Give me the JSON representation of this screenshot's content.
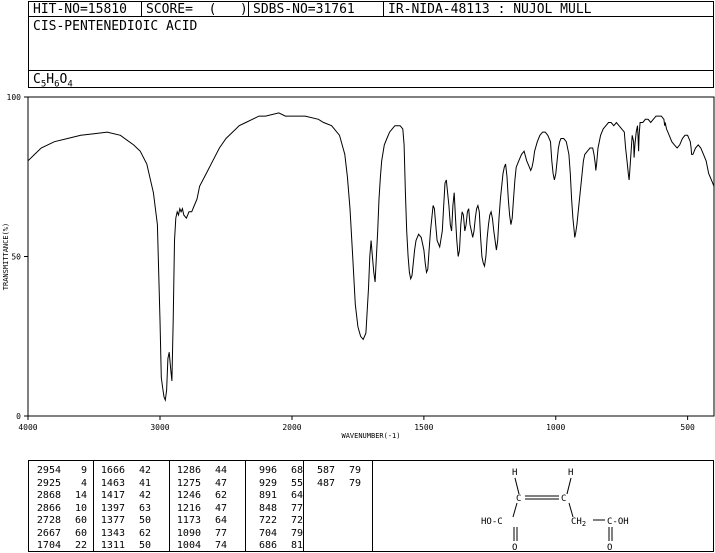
{
  "header": {
    "hit_no": "HIT-NO=15810",
    "score": "SCORE=  (   )",
    "sdbs_no": "SDBS-NO=31761",
    "ir_info": "IR-NIDA-48113 : NUJOL MULL"
  },
  "compound_name": "CIS-PENTENEDIOIC ACID",
  "formula": {
    "c": "C",
    "c_n": "5",
    "h": "H",
    "h_n": "6",
    "o": "O",
    "o_n": "4"
  },
  "chart_data": {
    "type": "line",
    "title": "",
    "xlabel": "WAVENUMBER(-1)",
    "ylabel": "TRANSMITTANCE(%)",
    "xlim": [
      4000,
      400
    ],
    "ylim": [
      0,
      100
    ],
    "x_ticks": [
      "4000",
      "3000",
      "2000",
      "1500",
      "1000",
      "500"
    ],
    "y_ticks": [
      "100",
      "50",
      "0"
    ],
    "grid": false,
    "series": [
      {
        "points": [
          [
            4000,
            80
          ],
          [
            3950,
            82
          ],
          [
            3900,
            84
          ],
          [
            3800,
            86
          ],
          [
            3700,
            87
          ],
          [
            3600,
            88
          ],
          [
            3500,
            88.5
          ],
          [
            3400,
            89
          ],
          [
            3300,
            88
          ],
          [
            3200,
            85
          ],
          [
            3150,
            83
          ],
          [
            3100,
            79
          ],
          [
            3050,
            70
          ],
          [
            3020,
            60
          ],
          [
            3000,
            30
          ],
          [
            2990,
            12
          ],
          [
            2980,
            9
          ],
          [
            2970,
            6
          ],
          [
            2960,
            5
          ],
          [
            2950,
            8
          ],
          [
            2940,
            18
          ],
          [
            2930,
            20
          ],
          [
            2920,
            15
          ],
          [
            2910,
            11
          ],
          [
            2900,
            30
          ],
          [
            2890,
            55
          ],
          [
            2880,
            62
          ],
          [
            2870,
            64
          ],
          [
            2860,
            63
          ],
          [
            2850,
            65
          ],
          [
            2840,
            64
          ],
          [
            2830,
            65
          ],
          [
            2820,
            63
          ],
          [
            2800,
            62
          ],
          [
            2780,
            64
          ],
          [
            2760,
            64
          ],
          [
            2740,
            66
          ],
          [
            2720,
            68
          ],
          [
            2700,
            72
          ],
          [
            2650,
            76
          ],
          [
            2600,
            80
          ],
          [
            2550,
            84
          ],
          [
            2500,
            87
          ],
          [
            2450,
            89
          ],
          [
            2400,
            91
          ],
          [
            2350,
            92
          ],
          [
            2300,
            93
          ],
          [
            2250,
            94
          ],
          [
            2200,
            94
          ],
          [
            2100,
            95
          ],
          [
            2050,
            94
          ],
          [
            2000,
            94
          ],
          [
            1950,
            94
          ],
          [
            1900,
            93
          ],
          [
            1880,
            92
          ],
          [
            1850,
            91
          ],
          [
            1820,
            88
          ],
          [
            1800,
            82
          ],
          [
            1790,
            75
          ],
          [
            1780,
            65
          ],
          [
            1770,
            50
          ],
          [
            1760,
            35
          ],
          [
            1750,
            28
          ],
          [
            1740,
            25
          ],
          [
            1730,
            24
          ],
          [
            1720,
            26
          ],
          [
            1710,
            40
          ],
          [
            1705,
            50
          ],
          [
            1700,
            55
          ],
          [
            1695,
            50
          ],
          [
            1690,
            45
          ],
          [
            1685,
            42
          ],
          [
            1680,
            50
          ],
          [
            1675,
            58
          ],
          [
            1670,
            68
          ],
          [
            1665,
            75
          ],
          [
            1660,
            80
          ],
          [
            1650,
            85
          ],
          [
            1640,
            87
          ],
          [
            1630,
            89
          ],
          [
            1620,
            90
          ],
          [
            1610,
            91
          ],
          [
            1600,
            91
          ],
          [
            1590,
            91
          ],
          [
            1580,
            90
          ],
          [
            1575,
            85
          ],
          [
            1570,
            70
          ],
          [
            1565,
            58
          ],
          [
            1560,
            50
          ],
          [
            1555,
            45
          ],
          [
            1550,
            43
          ],
          [
            1545,
            44
          ],
          [
            1540,
            48
          ],
          [
            1535,
            52
          ],
          [
            1530,
            55
          ],
          [
            1520,
            57
          ],
          [
            1510,
            56
          ],
          [
            1500,
            52
          ],
          [
            1495,
            48
          ],
          [
            1490,
            45
          ],
          [
            1485,
            46
          ],
          [
            1480,
            52
          ],
          [
            1475,
            58
          ],
          [
            1470,
            62
          ],
          [
            1465,
            66
          ],
          [
            1460,
            65
          ],
          [
            1455,
            60
          ],
          [
            1450,
            55
          ],
          [
            1440,
            53
          ],
          [
            1430,
            58
          ],
          [
            1425,
            66
          ],
          [
            1420,
            73
          ],
          [
            1415,
            74
          ],
          [
            1410,
            70
          ],
          [
            1405,
            66
          ],
          [
            1400,
            60
          ],
          [
            1395,
            58
          ],
          [
            1390,
            66
          ],
          [
            1385,
            70
          ],
          [
            1380,
            62
          ],
          [
            1375,
            55
          ],
          [
            1370,
            50
          ],
          [
            1365,
            52
          ],
          [
            1360,
            60
          ],
          [
            1355,
            64
          ],
          [
            1350,
            63
          ],
          [
            1345,
            58
          ],
          [
            1340,
            60
          ],
          [
            1335,
            64
          ],
          [
            1330,
            65
          ],
          [
            1325,
            60
          ],
          [
            1320,
            58
          ],
          [
            1315,
            56
          ],
          [
            1310,
            58
          ],
          [
            1305,
            62
          ],
          [
            1300,
            65
          ],
          [
            1295,
            66
          ],
          [
            1290,
            64
          ],
          [
            1285,
            56
          ],
          [
            1280,
            50
          ],
          [
            1275,
            48
          ],
          [
            1270,
            47
          ],
          [
            1265,
            50
          ],
          [
            1260,
            56
          ],
          [
            1255,
            60
          ],
          [
            1250,
            63
          ],
          [
            1245,
            64
          ],
          [
            1240,
            62
          ],
          [
            1235,
            58
          ],
          [
            1230,
            55
          ],
          [
            1225,
            52
          ],
          [
            1220,
            55
          ],
          [
            1215,
            62
          ],
          [
            1210,
            68
          ],
          [
            1205,
            72
          ],
          [
            1200,
            76
          ],
          [
            1195,
            78
          ],
          [
            1190,
            79
          ],
          [
            1185,
            75
          ],
          [
            1180,
            68
          ],
          [
            1175,
            63
          ],
          [
            1170,
            60
          ],
          [
            1165,
            62
          ],
          [
            1160,
            68
          ],
          [
            1155,
            74
          ],
          [
            1150,
            78
          ],
          [
            1140,
            80
          ],
          [
            1130,
            82
          ],
          [
            1120,
            83
          ],
          [
            1110,
            80
          ],
          [
            1100,
            78
          ],
          [
            1095,
            77
          ],
          [
            1090,
            78
          ],
          [
            1085,
            80
          ],
          [
            1080,
            83
          ],
          [
            1070,
            86
          ],
          [
            1060,
            88
          ],
          [
            1050,
            89
          ],
          [
            1040,
            89
          ],
          [
            1030,
            88
          ],
          [
            1020,
            86
          ],
          [
            1015,
            80
          ],
          [
            1010,
            76
          ],
          [
            1005,
            74
          ],
          [
            1000,
            76
          ],
          [
            995,
            80
          ],
          [
            990,
            84
          ],
          [
            985,
            86
          ],
          [
            980,
            87
          ],
          [
            970,
            87
          ],
          [
            960,
            86
          ],
          [
            950,
            82
          ],
          [
            945,
            76
          ],
          [
            940,
            68
          ],
          [
            935,
            62
          ],
          [
            930,
            58
          ],
          [
            928,
            56
          ],
          [
            925,
            57
          ],
          [
            920,
            60
          ],
          [
            915,
            64
          ],
          [
            910,
            68
          ],
          [
            905,
            72
          ],
          [
            900,
            76
          ],
          [
            895,
            80
          ],
          [
            890,
            82
          ],
          [
            880,
            83
          ],
          [
            870,
            84
          ],
          [
            860,
            84
          ],
          [
            855,
            82
          ],
          [
            850,
            79
          ],
          [
            848,
            77
          ],
          [
            845,
            79
          ],
          [
            840,
            84
          ],
          [
            830,
            88
          ],
          [
            820,
            90
          ],
          [
            810,
            91
          ],
          [
            800,
            92
          ],
          [
            790,
            92
          ],
          [
            780,
            91
          ],
          [
            770,
            92
          ],
          [
            760,
            91
          ],
          [
            750,
            90
          ],
          [
            740,
            89
          ],
          [
            735,
            84
          ],
          [
            730,
            80
          ],
          [
            725,
            76
          ],
          [
            722,
            74
          ],
          [
            720,
            76
          ],
          [
            715,
            82
          ],
          [
            710,
            88
          ],
          [
            705,
            86
          ],
          [
            703,
            81
          ],
          [
            700,
            85
          ],
          [
            695,
            89
          ],
          [
            690,
            91
          ],
          [
            688,
            88
          ],
          [
            686,
            83
          ],
          [
            684,
            88
          ],
          [
            680,
            92
          ],
          [
            670,
            92
          ],
          [
            660,
            93
          ],
          [
            650,
            93
          ],
          [
            640,
            92
          ],
          [
            630,
            93
          ],
          [
            620,
            94
          ],
          [
            610,
            94
          ],
          [
            600,
            94
          ],
          [
            590,
            93
          ],
          [
            587,
            91
          ],
          [
            585,
            92
          ],
          [
            580,
            90
          ],
          [
            570,
            88
          ],
          [
            560,
            86
          ],
          [
            550,
            85
          ],
          [
            540,
            84
          ],
          [
            530,
            85
          ],
          [
            520,
            87
          ],
          [
            510,
            88
          ],
          [
            500,
            88
          ],
          [
            490,
            86
          ],
          [
            487,
            84
          ],
          [
            485,
            82
          ],
          [
            480,
            82
          ],
          [
            470,
            84
          ],
          [
            460,
            85
          ],
          [
            450,
            84
          ],
          [
            440,
            82
          ],
          [
            430,
            80
          ],
          [
            420,
            76
          ],
          [
            410,
            74
          ],
          [
            400,
            72
          ]
        ]
      }
    ]
  },
  "peaks": [
    [
      [
        "2954",
        "9"
      ],
      [
        "2925",
        "4"
      ],
      [
        "2868",
        "14"
      ],
      [
        "2866",
        "10"
      ],
      [
        "2728",
        "60"
      ],
      [
        "2667",
        "60"
      ],
      [
        "1704",
        "22"
      ]
    ],
    [
      [
        "1666",
        "42"
      ],
      [
        "1463",
        "41"
      ],
      [
        "1417",
        "42"
      ],
      [
        "1397",
        "63"
      ],
      [
        "1377",
        "50"
      ],
      [
        "1343",
        "62"
      ],
      [
        "1311",
        "50"
      ]
    ],
    [
      [
        "1286",
        "44"
      ],
      [
        "1275",
        "47"
      ],
      [
        "1246",
        "62"
      ],
      [
        "1216",
        "47"
      ],
      [
        "1173",
        "64"
      ],
      [
        "1090",
        "77"
      ],
      [
        "1004",
        "74"
      ]
    ],
    [
      [
        "996",
        "68"
      ],
      [
        "929",
        "55"
      ],
      [
        "891",
        "64"
      ],
      [
        "848",
        "77"
      ],
      [
        "722",
        "72"
      ],
      [
        "704",
        "79"
      ],
      [
        "686",
        "81"
      ]
    ],
    [
      [
        "587",
        "79"
      ],
      [
        "487",
        "79"
      ]
    ]
  ],
  "structure": {
    "h_left": "H",
    "h_right": "H",
    "c_left": "C",
    "c_right": "C",
    "left_group": "HO-C",
    "left_oxygen": "O",
    "ch2_c": "CH",
    "ch2_n": "2",
    "right_group": "C-OH",
    "right_oxygen": "O"
  },
  "colors": {
    "line": "#000000",
    "background": "#ffffff"
  }
}
